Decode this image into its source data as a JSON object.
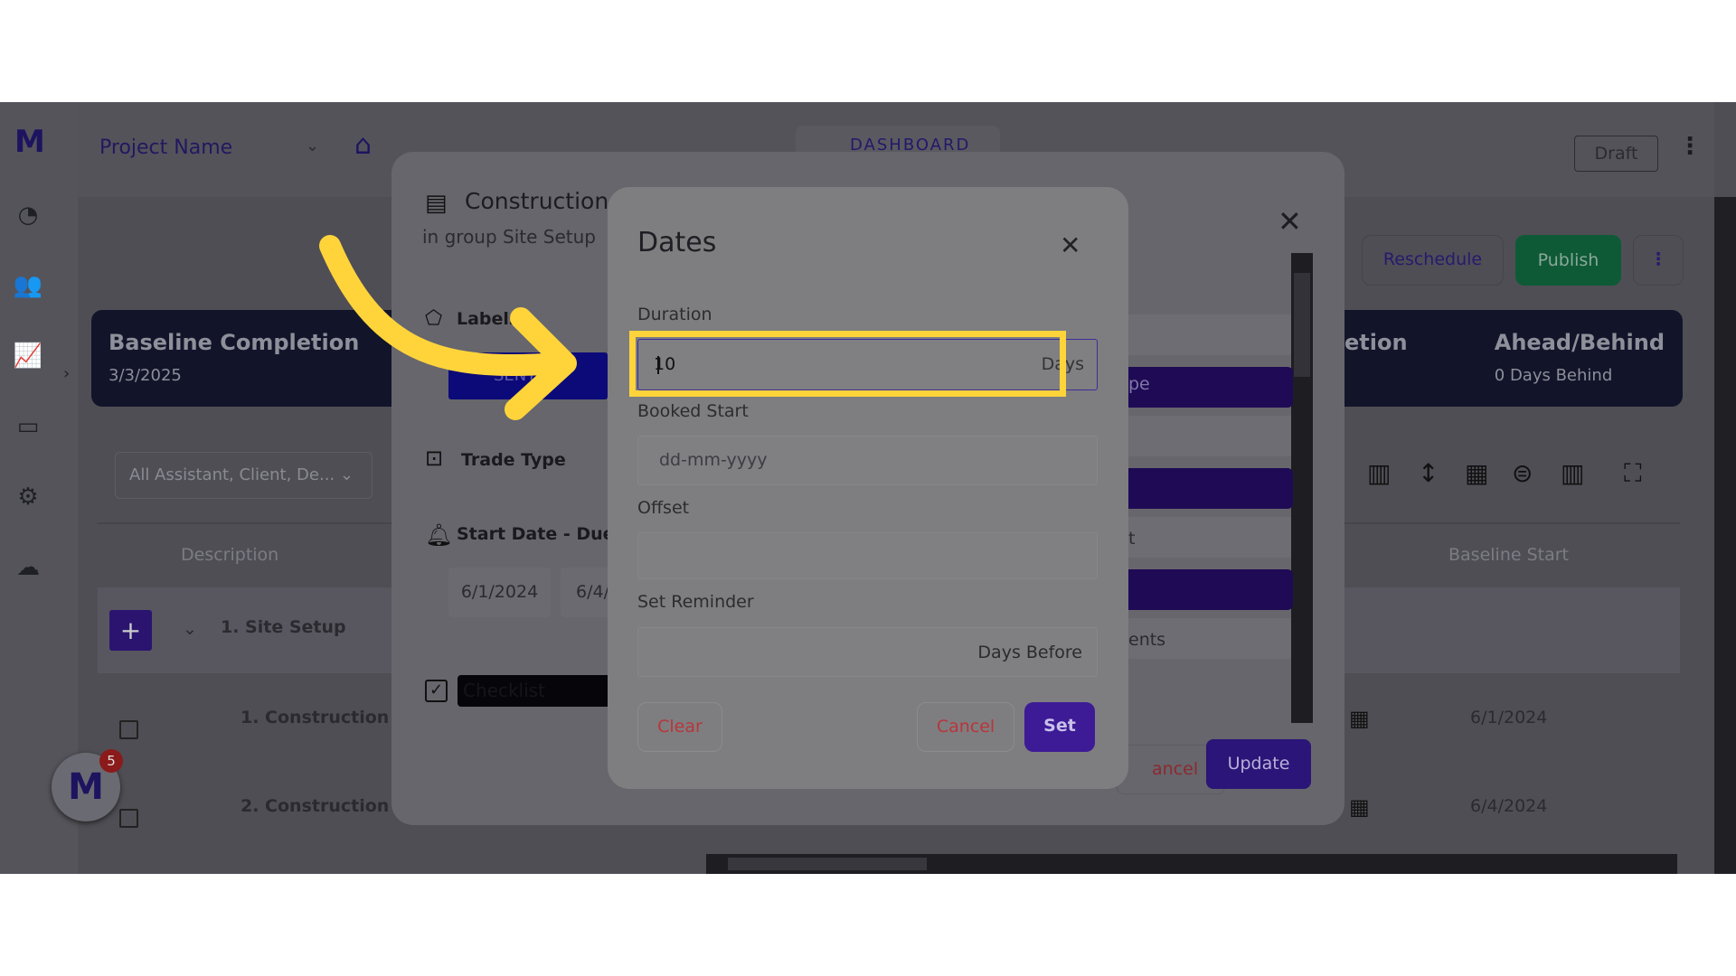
{
  "header": {
    "project_name": "Project Name",
    "dashboard_tab": "DASHBOARD",
    "draft_label": "Draft"
  },
  "sidebar": {
    "items": [
      "dashboard-icon",
      "team-icon",
      "analytics-icon",
      "presentation-icon",
      "settings-icon",
      "cloud-icon"
    ]
  },
  "toolbar": {
    "reschedule": "Reschedule",
    "publish": "Publish"
  },
  "cards": {
    "baseline_title": "Baseline Completion",
    "baseline_value": "3/3/2025",
    "partial_title": "etion",
    "ahead_title": "Ahead/Behind",
    "ahead_value": "0 Days Behind"
  },
  "filter": {
    "value": "All Assistant, Client, De..."
  },
  "table": {
    "headers": [
      "Description",
      "Baseline Start"
    ],
    "group": "1. Site Setup",
    "rows": [
      {
        "name": "1. Construction St",
        "baseline_start": "6/1/2024"
      },
      {
        "name": "2. Construction F",
        "baseline_start": "6/4/2024"
      }
    ]
  },
  "task_modal": {
    "title": "Construction",
    "subtitle": "in group Site Setup",
    "labels": "Labels",
    "label_chip": "SENT",
    "trade_type": "Trade Type",
    "start_due": "Start Date - Due D",
    "start_date": "6/1/2024",
    "due_date": "6/4/",
    "checklist": "Checklist",
    "side_text": [
      "pe",
      "t",
      "ents"
    ],
    "cancel": "ancel",
    "update": "Update"
  },
  "dates_dialog": {
    "title": "Dates",
    "duration_label": "Duration",
    "duration_value": "10",
    "duration_unit": "Days",
    "booked_start_label": "Booked Start",
    "booked_start_placeholder": "dd-mm-yyyy",
    "offset_label": "Offset",
    "offset_value": "",
    "reminder_label": "Set Reminder",
    "reminder_unit": "Days Before",
    "clear": "Clear",
    "cancel": "Cancel",
    "set": "Set"
  },
  "notifications": {
    "count": "5"
  },
  "colors": {
    "accent": "#3d1b96",
    "publish": "#0e5a36",
    "highlight": "#ffd43b",
    "clear": "#c0393b"
  }
}
